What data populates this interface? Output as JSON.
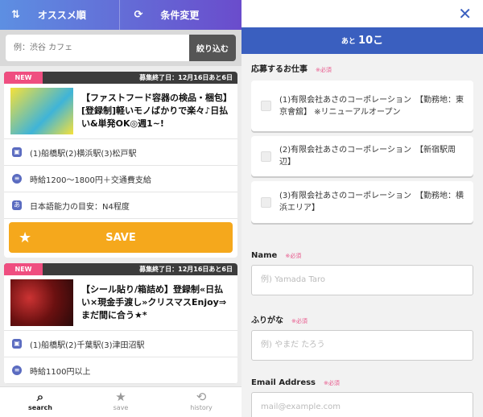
{
  "header": {
    "sort_label": "オススメ順",
    "filter_label": "条件変更"
  },
  "search": {
    "placeholder": "例：渋谷 カフェ",
    "button": "絞り込む"
  },
  "jobs": [
    {
      "badge": "NEW",
      "deadline": "募集終了日：12月16日あと6日",
      "title": "【ファストフード容器の検品・梱包】[登録制]軽いモノばかりで楽々♪日払い&単発OK◎週1~!",
      "station": "(1)船橋駅(2)横浜駅(3)松戸駅",
      "wage": "時給1200〜1800円＋交通費支給",
      "language": "日本語能力の目安：N4程度",
      "save": "SAVE"
    },
    {
      "badge": "NEW",
      "deadline": "募集終了日：12月16日あと6日",
      "title": "【シール貼り/箱詰め】登録制«日払い×現金手渡し»クリスマスEnjoy⇒まだ間に合う★*",
      "station": "(1)船橋駅(2)千葉駅(3)津田沼駅",
      "wage": "時給1100円以上"
    }
  ],
  "nav": [
    {
      "label": "search"
    },
    {
      "label": "save"
    },
    {
      "label": "history"
    }
  ],
  "form": {
    "remaining_prefix": "あと",
    "remaining_count": "10こ",
    "jobs_label": "応募するお仕事",
    "required": "※必須",
    "job_options": [
      "(1)有限会社あさのコーポレーション　【勤務地：東京會舘】 ※リニューアルオープン",
      "(2)有限会社あさのコーポレーション　【新宿駅周辺】",
      "(3)有限会社あさのコーポレーション　【勤務地：横浜エリア】"
    ],
    "name_label": "Name",
    "name_placeholder": "例) Yamada Taro",
    "kana_label": "ふりがな",
    "kana_placeholder": "例) やまだ たろう",
    "email_label": "Email Address",
    "email_placeholder": "mail@example.com"
  }
}
